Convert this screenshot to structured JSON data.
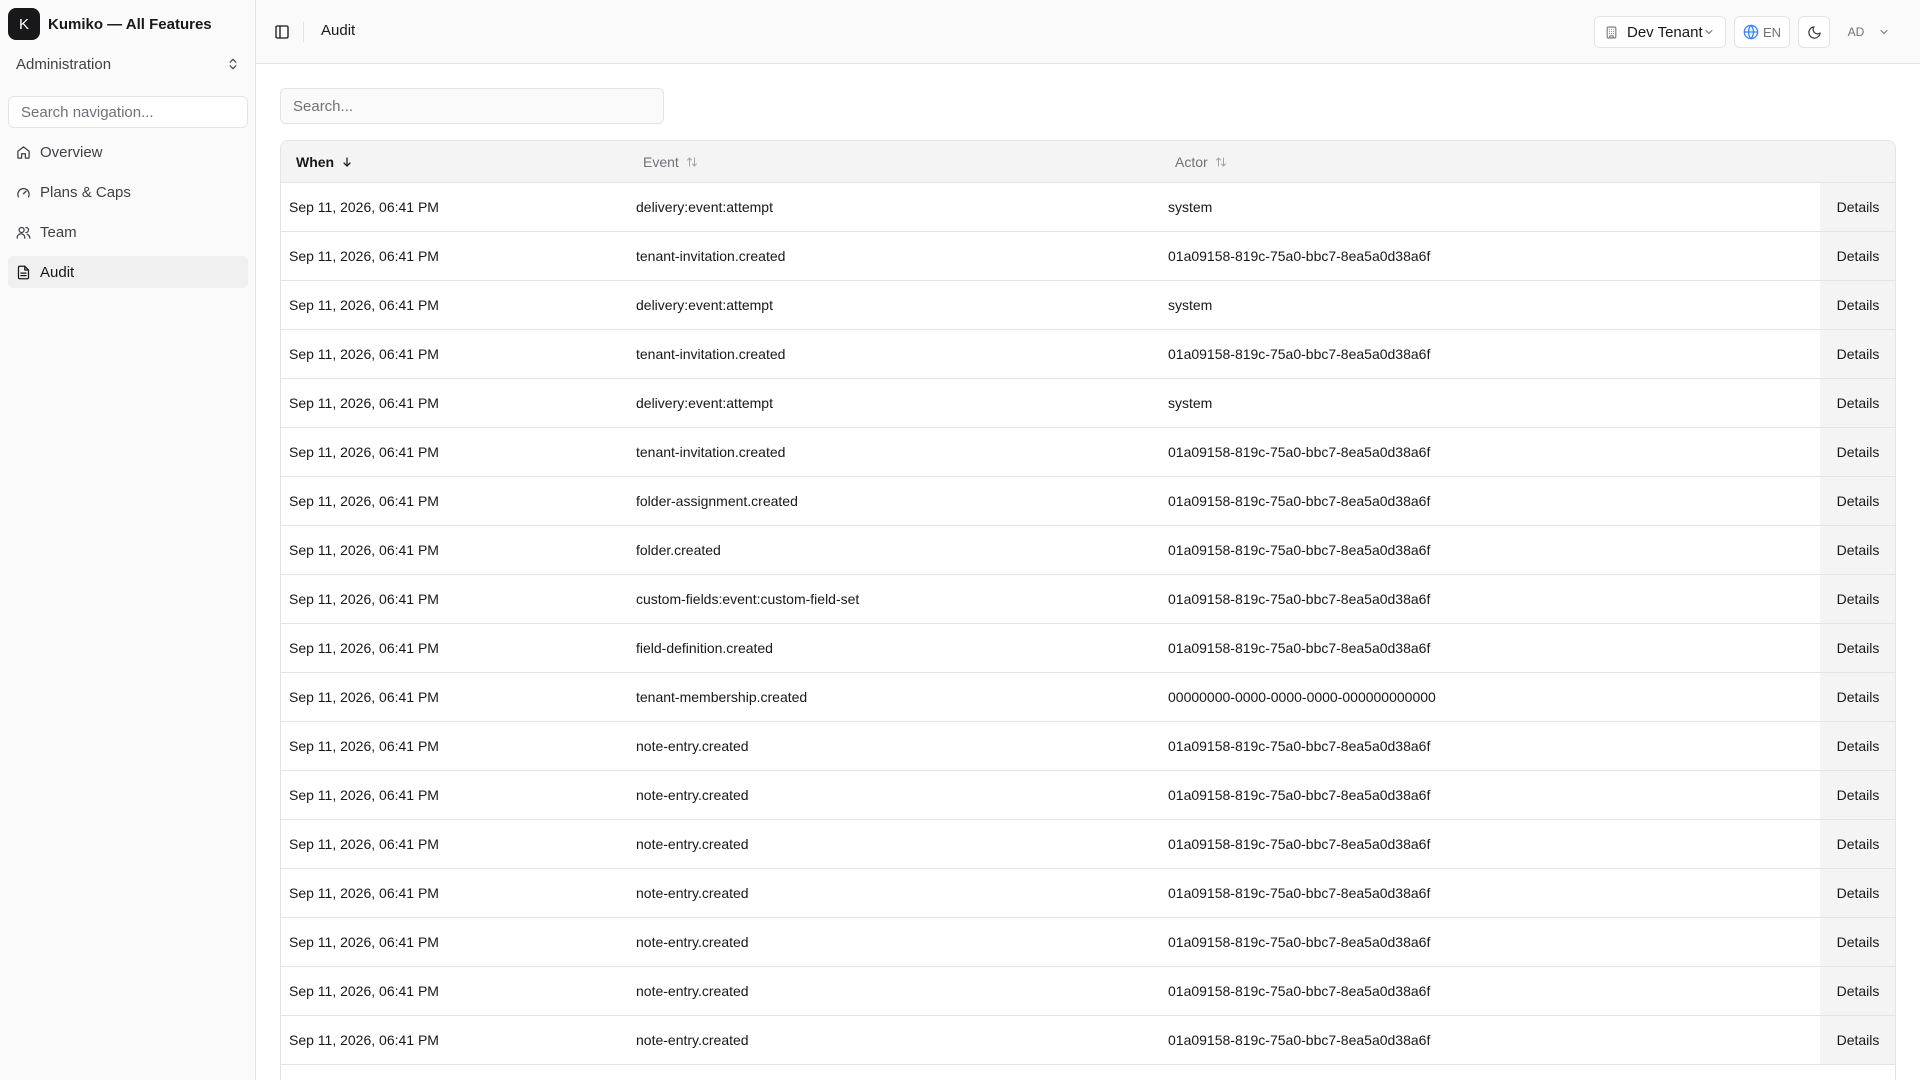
{
  "sidebar": {
    "brand_letter": "K",
    "brand_title": "Kumiko — All Features",
    "section": "Administration",
    "search_placeholder": "Search navigation...",
    "items": [
      {
        "label": "Overview",
        "icon": "home-icon"
      },
      {
        "label": "Plans & Caps",
        "icon": "gauge-icon"
      },
      {
        "label": "Team",
        "icon": "users-icon"
      },
      {
        "label": "Audit",
        "icon": "file-text-icon",
        "active": true
      }
    ]
  },
  "header": {
    "breadcrumb": "Audit",
    "tenant": "Dev Tenant",
    "language": "EN",
    "user_initials": "AD"
  },
  "main": {
    "search_placeholder": "Search...",
    "columns": {
      "when": "When",
      "event": "Event",
      "actor": "Actor"
    },
    "sort": {
      "column": "when",
      "direction": "desc"
    },
    "details_label": "Details",
    "rows": [
      {
        "when": "Sep 11, 2026, 06:41 PM",
        "event": "delivery:event:attempt",
        "actor": "system"
      },
      {
        "when": "Sep 11, 2026, 06:41 PM",
        "event": "tenant-invitation.created",
        "actor": "01a09158-819c-75a0-bbc7-8ea5a0d38a6f"
      },
      {
        "when": "Sep 11, 2026, 06:41 PM",
        "event": "delivery:event:attempt",
        "actor": "system"
      },
      {
        "when": "Sep 11, 2026, 06:41 PM",
        "event": "tenant-invitation.created",
        "actor": "01a09158-819c-75a0-bbc7-8ea5a0d38a6f"
      },
      {
        "when": "Sep 11, 2026, 06:41 PM",
        "event": "delivery:event:attempt",
        "actor": "system"
      },
      {
        "when": "Sep 11, 2026, 06:41 PM",
        "event": "tenant-invitation.created",
        "actor": "01a09158-819c-75a0-bbc7-8ea5a0d38a6f"
      },
      {
        "when": "Sep 11, 2026, 06:41 PM",
        "event": "folder-assignment.created",
        "actor": "01a09158-819c-75a0-bbc7-8ea5a0d38a6f"
      },
      {
        "when": "Sep 11, 2026, 06:41 PM",
        "event": "folder.created",
        "actor": "01a09158-819c-75a0-bbc7-8ea5a0d38a6f"
      },
      {
        "when": "Sep 11, 2026, 06:41 PM",
        "event": "custom-fields:event:custom-field-set",
        "actor": "01a09158-819c-75a0-bbc7-8ea5a0d38a6f"
      },
      {
        "when": "Sep 11, 2026, 06:41 PM",
        "event": "field-definition.created",
        "actor": "01a09158-819c-75a0-bbc7-8ea5a0d38a6f"
      },
      {
        "when": "Sep 11, 2026, 06:41 PM",
        "event": "tenant-membership.created",
        "actor": "00000000-0000-0000-0000-000000000000"
      },
      {
        "when": "Sep 11, 2026, 06:41 PM",
        "event": "note-entry.created",
        "actor": "01a09158-819c-75a0-bbc7-8ea5a0d38a6f"
      },
      {
        "when": "Sep 11, 2026, 06:41 PM",
        "event": "note-entry.created",
        "actor": "01a09158-819c-75a0-bbc7-8ea5a0d38a6f"
      },
      {
        "when": "Sep 11, 2026, 06:41 PM",
        "event": "note-entry.created",
        "actor": "01a09158-819c-75a0-bbc7-8ea5a0d38a6f"
      },
      {
        "when": "Sep 11, 2026, 06:41 PM",
        "event": "note-entry.created",
        "actor": "01a09158-819c-75a0-bbc7-8ea5a0d38a6f"
      },
      {
        "when": "Sep 11, 2026, 06:41 PM",
        "event": "note-entry.created",
        "actor": "01a09158-819c-75a0-bbc7-8ea5a0d38a6f"
      },
      {
        "when": "Sep 11, 2026, 06:41 PM",
        "event": "note-entry.created",
        "actor": "01a09158-819c-75a0-bbc7-8ea5a0d38a6f"
      },
      {
        "when": "Sep 11, 2026, 06:41 PM",
        "event": "note-entry.created",
        "actor": "01a09158-819c-75a0-bbc7-8ea5a0d38a6f"
      }
    ]
  }
}
